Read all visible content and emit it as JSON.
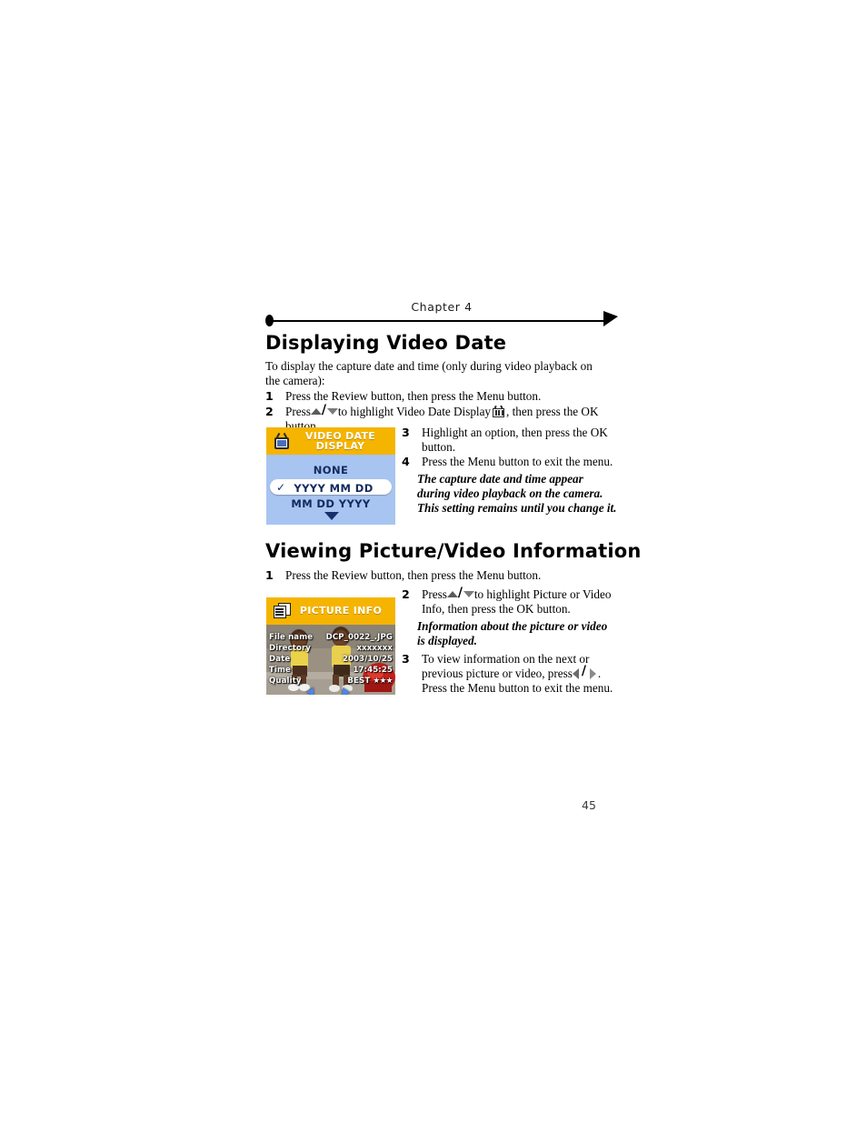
{
  "header": {
    "chapter_label": "Chapter 4"
  },
  "sections": {
    "video_date": {
      "heading": "Displaying Video Date",
      "intro": "To display the capture date and time (only during video playback on the camera):",
      "step1_num": "1",
      "step1_text": "Press the Review button, then press the Menu button.",
      "step2_num": "2",
      "step2_text_a": "Press",
      "step2_text_b": "to highlight Video Date Display",
      "step2_text_c": ", then press the OK button.",
      "step3_num": "3",
      "step3_text": "Highlight an option, then press the OK button.",
      "step4_num": "4",
      "step4_text": "Press the Menu button to exit the menu.",
      "note": "The capture date and time appear during video playback on the camera. This setting remains until you change it."
    },
    "viewing_info": {
      "heading": "Viewing Picture/Video Information",
      "step1_num": "1",
      "step1_text": "Press the Review button, then press the Menu button.",
      "step2_num": "2",
      "step2_text_a": "Press",
      "step2_text_b": "to highlight Picture or Video Info, then press the OK button.",
      "note": "Information about the picture or video is displayed.",
      "step3_num": "3",
      "step3_text_a": "To view information on the next or previous picture or video, press",
      "step3_text_b": ". Press the Menu button to exit the menu."
    }
  },
  "lcd_video_date": {
    "icon": "tv-video-icon",
    "title_line1": "VIDEO DATE",
    "title_line2": "DISPLAY",
    "options": [
      {
        "label": "NONE",
        "selected": false
      },
      {
        "label": "YYYY MM DD",
        "selected": true
      },
      {
        "label": "MM DD YYYY",
        "selected": false
      }
    ],
    "check_glyph": "✓",
    "scroll_indicator": "scroll-down-icon",
    "header_bg": "#f5b400",
    "body_bg": "#a8c4f0",
    "text_color": "#122a5e"
  },
  "lcd_picture_info": {
    "icon": "document-list-icon",
    "title": "PICTURE INFO",
    "rows": [
      {
        "key": "File name",
        "value": "DCP_0022_.JPG"
      },
      {
        "key": "Directory",
        "value": "xxxxxxx"
      },
      {
        "key": "Date",
        "value": "2003/10/25"
      },
      {
        "key": "Time",
        "value": "17:45:25"
      },
      {
        "key": "Quality",
        "value": "BEST"
      }
    ],
    "quality_stars": "★★★",
    "nav_prev": "nav-previous-icon",
    "nav_next": "nav-next-icon",
    "header_bg": "#f5b400"
  },
  "footer": {
    "page_number": "45"
  }
}
